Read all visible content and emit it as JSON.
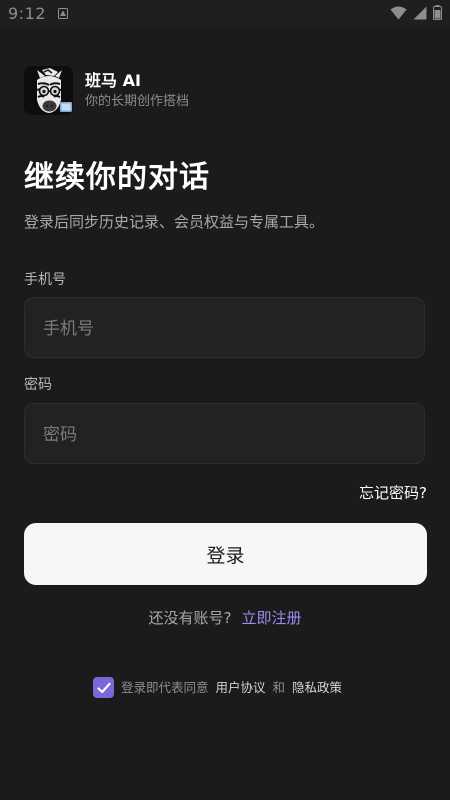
{
  "status_bar": {
    "time": "9:12",
    "icons": [
      "notification-icon",
      "wifi-icon",
      "signal-icon",
      "battery-icon"
    ]
  },
  "brand": {
    "name": "班马 AI",
    "tagline": "你的长期创作搭档",
    "logo_icon": "zebra-logo"
  },
  "header": {
    "title": "继续你的对话",
    "subtitle": "登录后同步历史记录、会员权益与专属工具。"
  },
  "form": {
    "phone": {
      "label": "手机号",
      "placeholder": "手机号",
      "value": ""
    },
    "password": {
      "label": "密码",
      "placeholder": "密码",
      "value": ""
    },
    "forgot_label": "忘记密码?",
    "submit_label": "登录"
  },
  "register": {
    "prompt": "还没有账号?",
    "link_label": "立即注册"
  },
  "agreement": {
    "checked": true,
    "prefix": "登录即代表同意",
    "terms_label": "用户协议",
    "and_text": "和",
    "privacy_label": "隐私政策"
  },
  "colors": {
    "background": "#1b1b1c",
    "accent": "#7a68d8",
    "link": "#9b8cf0",
    "button": "#f7f7f7"
  }
}
